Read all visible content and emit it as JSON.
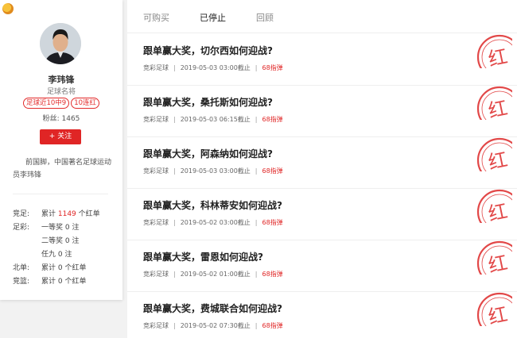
{
  "profile": {
    "name": "李玮锋",
    "title": "足球名将",
    "badges": [
      "足球近10中9",
      "10连红"
    ],
    "fans_label": "粉丝:",
    "fans_count": "1465",
    "follow_label": "+ 关注",
    "bio": "前国脚，中国著名足球运动员李玮锋"
  },
  "stats": [
    {
      "label": "竞足:",
      "prefix": "累计 ",
      "number": "1149",
      "suffix": " 个红单"
    },
    {
      "label": "足彩:",
      "prefix": "一等奖 0 注",
      "number": "",
      "suffix": ""
    },
    {
      "label": "",
      "prefix": "二等奖 0 注",
      "number": "",
      "suffix": ""
    },
    {
      "label": "",
      "prefix": "任九 0 注",
      "number": "",
      "suffix": ""
    },
    {
      "label": "北单:",
      "prefix": "累计 0 个红单",
      "number": "",
      "suffix": ""
    },
    {
      "label": "竞篮:",
      "prefix": "累计 0 个红单",
      "number": "",
      "suffix": ""
    }
  ],
  "tabs": [
    "可购买",
    "已停止",
    "回顾"
  ],
  "active_tab": "已停止",
  "items": [
    {
      "title": "跟单赢大奖，切尔西如何迎战?",
      "category": "竞彩足球",
      "time": "2019-05-03 03:00截止",
      "price": "68指弹"
    },
    {
      "title": "跟单赢大奖，桑托斯如何迎战?",
      "category": "竞彩足球",
      "time": "2019-05-03 06:15截止",
      "price": "68指弹"
    },
    {
      "title": "跟单赢大奖，阿森纳如何迎战?",
      "category": "竞彩足球",
      "time": "2019-05-03 03:00截止",
      "price": "68指弹"
    },
    {
      "title": "跟单赢大奖，科林蒂安如何迎战?",
      "category": "竞彩足球",
      "time": "2019-05-02 03:00截止",
      "price": "68指弹"
    },
    {
      "title": "跟单赢大奖，雷恩如何迎战?",
      "category": "竞彩足球",
      "time": "2019-05-02 01:00截止",
      "price": "68指弹"
    },
    {
      "title": "跟单赢大奖，费城联合如何迎战?",
      "category": "竞彩足球",
      "time": "2019-05-02 07:30截止",
      "price": "68指弹"
    }
  ],
  "stamp_text": "红",
  "colors": {
    "accent": "#e02525"
  }
}
